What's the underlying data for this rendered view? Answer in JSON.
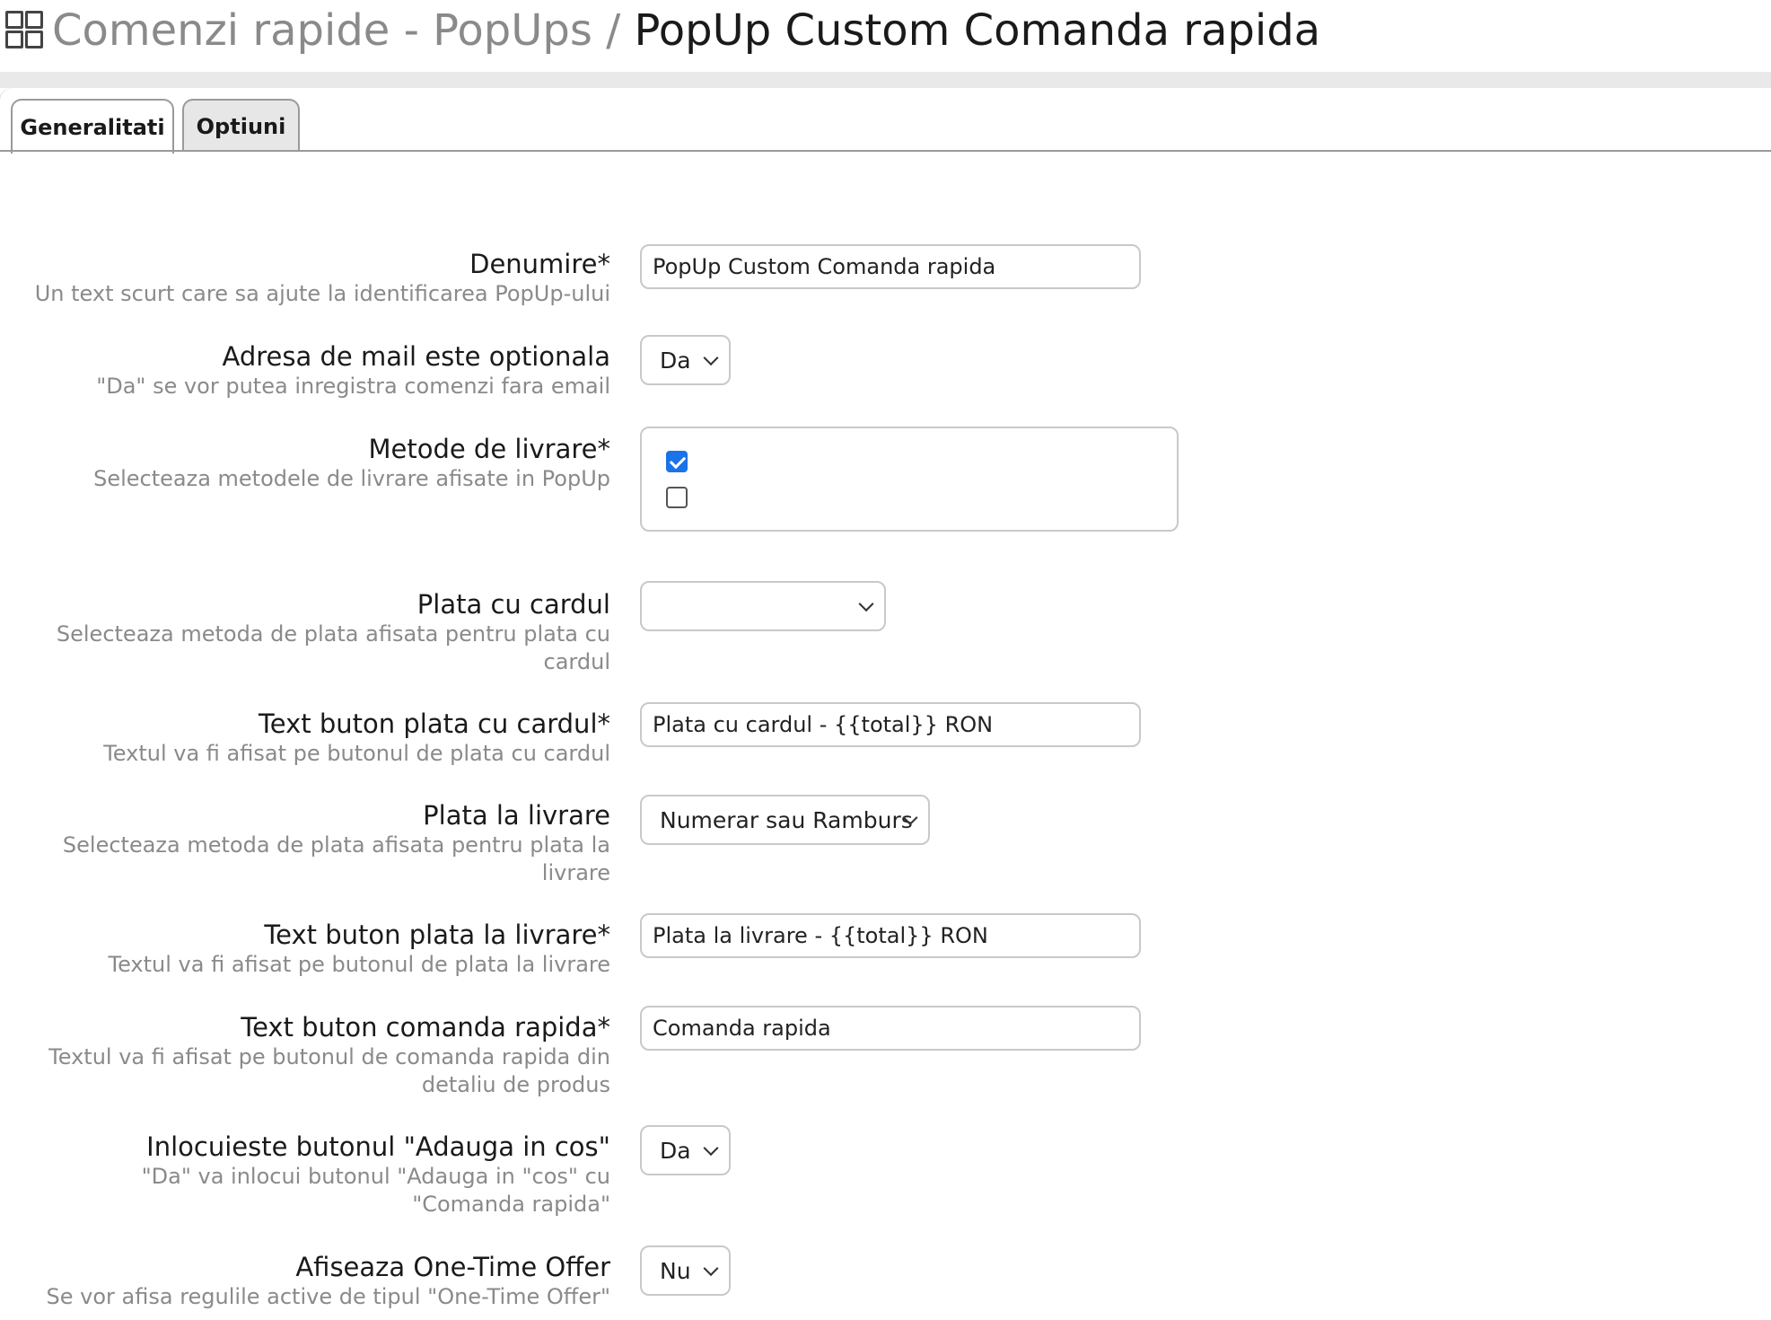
{
  "header": {
    "breadcrumb_parent": "Comenzi rapide - PopUps",
    "separator": " / ",
    "page_title": "PopUp Custom Comanda rapida"
  },
  "tabs": [
    {
      "label": "Generalitati",
      "active": true
    },
    {
      "label": "Optiuni",
      "active": false
    }
  ],
  "form": {
    "name": {
      "label": "Denumire*",
      "hint": "Un text scurt care sa ajute la identificarea PopUp-ului",
      "value": "PopUp Custom Comanda rapida"
    },
    "email_optional": {
      "label": "Adresa de mail este optionala",
      "hint": "\"Da\" se vor putea inregistra comenzi fara email",
      "value": "Da"
    },
    "delivery_methods": {
      "label": "Metode de livrare*",
      "hint": "Selecteaza metodele de livrare afisate in PopUp",
      "options": [
        {
          "checked": true
        },
        {
          "checked": false
        }
      ]
    },
    "card_payment": {
      "label": "Plata cu cardul",
      "hint_line1": "Selecteaza metoda de plata afisata pentru plata cu",
      "hint_line2": "cardul",
      "value": ""
    },
    "card_button_text": {
      "label": "Text buton plata cu cardul*",
      "hint": "Textul va fi afisat pe butonul de plata cu cardul",
      "value": "Plata cu cardul - {{total}} RON"
    },
    "cod_payment": {
      "label": "Plata la livrare",
      "hint_line1": "Selecteaza metoda de plata afisata pentru plata la",
      "hint_line2": "livrare",
      "value": "Numerar sau Ramburs"
    },
    "cod_button_text": {
      "label": "Text buton plata la livrare*",
      "hint": "Textul va fi afisat pe butonul de plata la livrare",
      "value": "Plata la livrare - {{total}} RON"
    },
    "quick_order_text": {
      "label": "Text buton comanda rapida*",
      "hint_line1": "Textul va fi afisat pe butonul de comanda rapida din",
      "hint_line2": "detaliu de produs",
      "value": "Comanda rapida"
    },
    "replace_add_to_cart": {
      "label": "Inlocuieste butonul \"Adauga in cos\"",
      "hint_line1": "\"Da\" va inlocui butonul \"Adauga in \"cos\" cu",
      "hint_line2": "\"Comanda rapida\"",
      "value": "Da"
    },
    "one_time_offer": {
      "label": "Afiseaza One-Time Offer",
      "hint": "Se vor afisa regulile active de tipul \"One-Time Offer\"",
      "value": "Nu"
    }
  },
  "colors": {
    "accent": "#1a73e8",
    "hint_text": "#8a8a8a",
    "border": "#c9c9c9"
  }
}
